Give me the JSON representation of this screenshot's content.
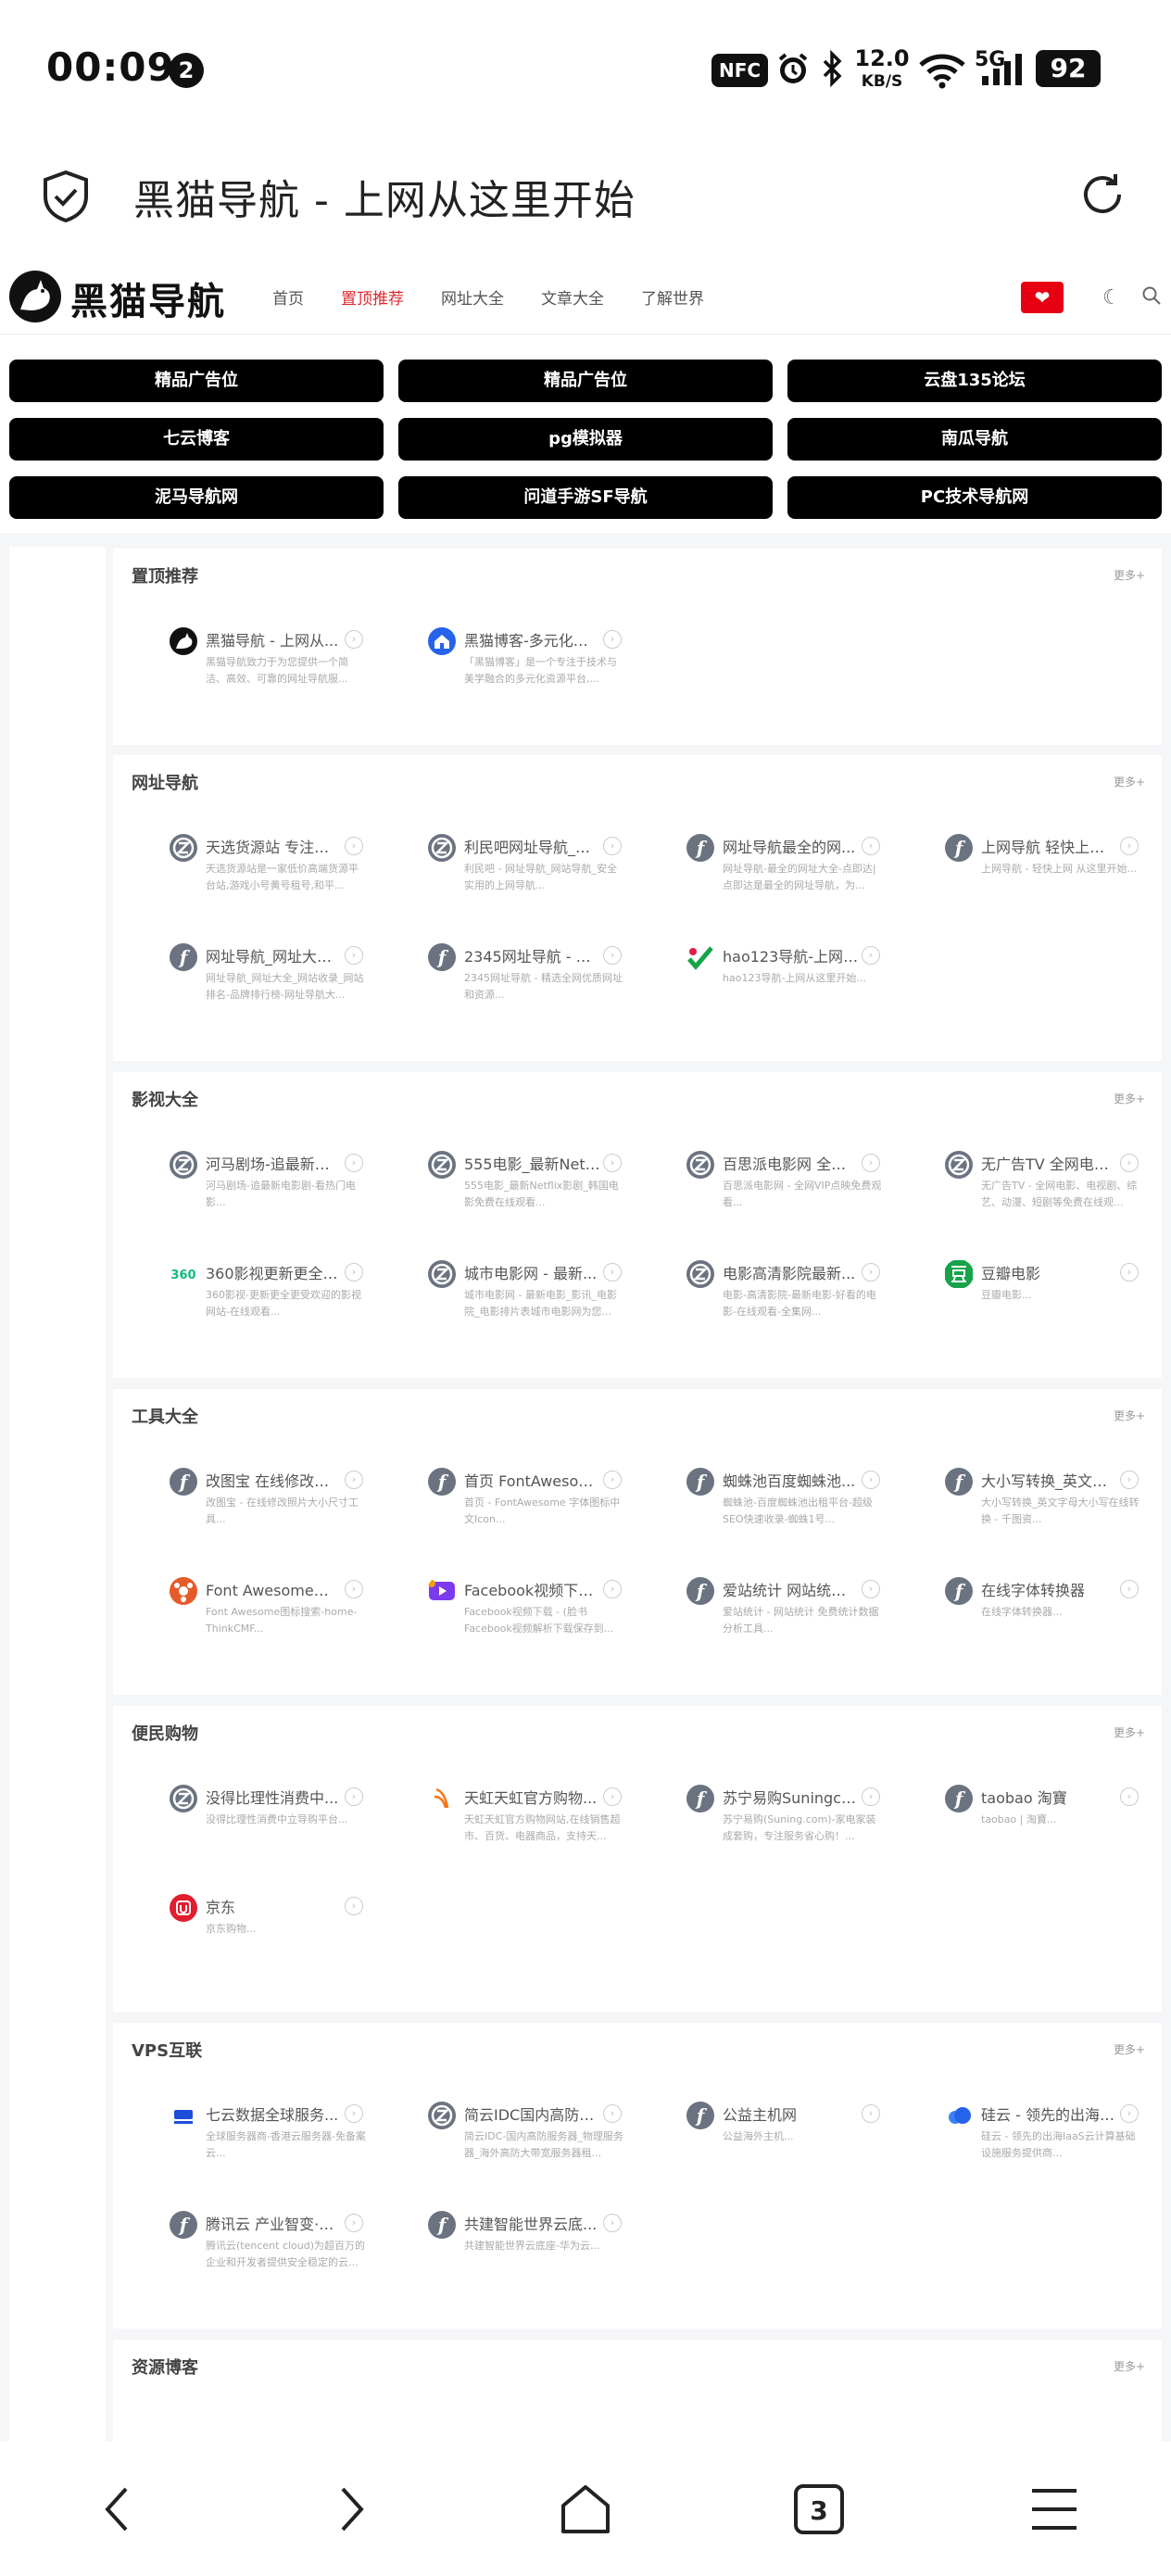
{
  "status_bar": {
    "time": "00:09",
    "notif_count": "2",
    "nfc": "NFC",
    "speed": "12.0",
    "speed_unit": "KB/S",
    "network": "5G",
    "battery": "92"
  },
  "browser": {
    "page_title": "黑猫导航 - 上网从这里开始",
    "tab_count": "3"
  },
  "header": {
    "logo_text": "黑猫导航",
    "nav": [
      "首页",
      "置顶推荐",
      "网址大全",
      "文章大全",
      "了解世界"
    ],
    "active_nav": "置顶推荐"
  },
  "ads": [
    "精品广告位",
    "精品广告位",
    "云盘135论坛",
    "七云博客",
    "pg模拟器",
    "南瓜导航",
    "泥马导航网",
    "问道手游SF导航",
    "PC技术导航网"
  ],
  "more_label": "更多+",
  "sections": [
    {
      "title": "置顶推荐",
      "cards": [
        {
          "title": "黑猫导航 - 上网从...",
          "desc": "黑猫导航致力于为您提供一个简洁、高效、可靠的网址导航服...",
          "icon": "cat-icon"
        },
        {
          "title": "黑猫博客-多元化资...",
          "desc": "「黑猫博客」是一个专注于技术与美学融合的多元化资源平台,...",
          "icon": "house-icon"
        }
      ]
    },
    {
      "title": "网址导航",
      "cards": [
        {
          "title": "天选货源站 专注于...",
          "desc": "天选货源站是一家低价高端货源平台站,游戏小号黄号租号,和平...",
          "icon": "z-icon"
        },
        {
          "title": "利民吧网址导航_网...",
          "desc": "利民吧 - 网址导航_网站导航_安全实用的上网导航...",
          "icon": "z-icon"
        },
        {
          "title": "网址导航最全的网...",
          "desc": "网址导航-最全的网址大全-点即达|点即达是最全的网址导航，为...",
          "icon": "f-icon"
        },
        {
          "title": "上网导航 轻快上网 ...",
          "desc": "上网导航 - 轻快上网 从这里开始...",
          "icon": "f-icon"
        },
        {
          "title": "网址导航_网址大全...",
          "desc": "网址导航_网址大全_网站收录_网站排名-品牌排行榜-网址导航大...",
          "icon": "f-icon"
        },
        {
          "title": "2345网址导航 - 精...",
          "desc": "2345网址导航 - 精选全网优质网址和资源...",
          "icon": "f-icon"
        },
        {
          "title": "hao123导航-上网从...",
          "desc": "hao123导航-上网从这里开始...",
          "icon": "hao123-icon"
        }
      ]
    },
    {
      "title": "影视大全",
      "cards": [
        {
          "title": "河马剧场-追最新电...",
          "desc": "河马剧场-追最新电影剧-看热门电影...",
          "icon": "z-icon"
        },
        {
          "title": "555电影_最新Netfli...",
          "desc": "555电影_最新Netflix影剧_韩国电影免费在线观看...",
          "icon": "z-icon"
        },
        {
          "title": "百思派电影网 全网...",
          "desc": "百思派电影网 - 全网VIP点映免费观看...",
          "icon": "z-icon"
        },
        {
          "title": "无广告TV 全网电影...",
          "desc": "无广告TV - 全网电影、电视剧、综艺、动漫、短剧等免费在线观...",
          "icon": "z-icon"
        },
        {
          "title": "360影视更新更全更...",
          "desc": "360影视-更新更全更受欢迎的影视网站-在线观看...",
          "icon": "360-icon"
        },
        {
          "title": "城市电影网 - 最新...",
          "desc": "城市电影网 - 最新电影_影讯_电影院_电影排片表城市电影网为您...",
          "icon": "z-icon"
        },
        {
          "title": "电影高清影院最新...",
          "desc": "电影-高清影院-最新电影-好看的电影-在线观看-全集网...",
          "icon": "z-icon"
        },
        {
          "title": "豆瓣电影",
          "desc": "豆瓣电影...",
          "icon": "douban-icon"
        }
      ]
    },
    {
      "title": "工具大全",
      "cards": [
        {
          "title": "改图宝 在线修改照...",
          "desc": "改图宝 - 在线修改照片大小尺寸工具...",
          "icon": "f-icon"
        },
        {
          "title": "首页 FontAwesome...",
          "desc": "首页 - FontAwesome 字体图标中文Icon...",
          "icon": "f-icon"
        },
        {
          "title": "蜘蛛池百度蜘蛛池...",
          "desc": "蜘蛛池-百度蜘蛛池出租平台-超级SEO快速收录-蜘蛛1号...",
          "icon": "f-icon"
        },
        {
          "title": "大小写转换_英文字...",
          "desc": "大小写转换_英文字母大小写在线转换 - 千图资...",
          "icon": "f-icon"
        },
        {
          "title": "Font Awesome图标...",
          "desc": "Font Awesome图标搜索-home-ThinkCMF...",
          "icon": "fa-icon"
        },
        {
          "title": "Facebook视频下载 ...",
          "desc": "Facebook视频下载 - (脸书Facebook视频解析下载保存到...",
          "icon": "video-icon"
        },
        {
          "title": "爱站统计 网站统计 ...",
          "desc": "爱站统计 - 网站统计 免费统计数据分析工具...",
          "icon": "f-icon"
        },
        {
          "title": "在线字体转换器",
          "desc": "在线字体转换器...",
          "icon": "f-icon"
        }
      ]
    },
    {
      "title": "便民购物",
      "cards": [
        {
          "title": "没得比理性消费中...",
          "desc": "没得比理性消费中立导购平台...",
          "icon": "z-icon"
        },
        {
          "title": "天虹天虹官方购物...",
          "desc": "天虹天虹官方购物网站,在线销售超市、百货、电器商品，支持天...",
          "icon": "tianhong-icon"
        },
        {
          "title": "苏宁易购Suningco...",
          "desc": "苏宁易购(Suning.com)-家电家装成套购，专注服务省心购！...",
          "icon": "f-icon"
        },
        {
          "title": "taobao 淘寶",
          "desc": "taobao | 淘寶...",
          "icon": "f-icon"
        },
        {
          "title": "京东",
          "desc": "京东购物...",
          "icon": "jd-icon"
        }
      ]
    },
    {
      "title": "VPS互联",
      "cards": [
        {
          "title": "七云数据全球服务...",
          "desc": "全球服务器商-香港云服务器-免备案云...",
          "icon": "cloud-blue-icon"
        },
        {
          "title": "简云IDC国内高防服...",
          "desc": "简云IDC-国内高防服务器_物理服务器_海外高防大带宽服务器租...",
          "icon": "z-icon"
        },
        {
          "title": "公益主机网",
          "desc": "公益海外主机...",
          "icon": "f-icon"
        },
        {
          "title": "硅云 - 领先的出海Ia...",
          "desc": "硅云 - 领先的出海IaaS云计算基础设施服务提供商...",
          "icon": "guiyun-icon"
        },
        {
          "title": "腾讯云 产业智变·云...",
          "desc": "腾讯云(tencent cloud)为超百万的企业和开发者提供安全稳定的云...",
          "icon": "f-icon"
        },
        {
          "title": "共建智能世界云底...",
          "desc": "共建智能世界云底座-华为云...",
          "icon": "f-icon"
        }
      ]
    },
    {
      "title": "资源博客",
      "cards": []
    }
  ]
}
